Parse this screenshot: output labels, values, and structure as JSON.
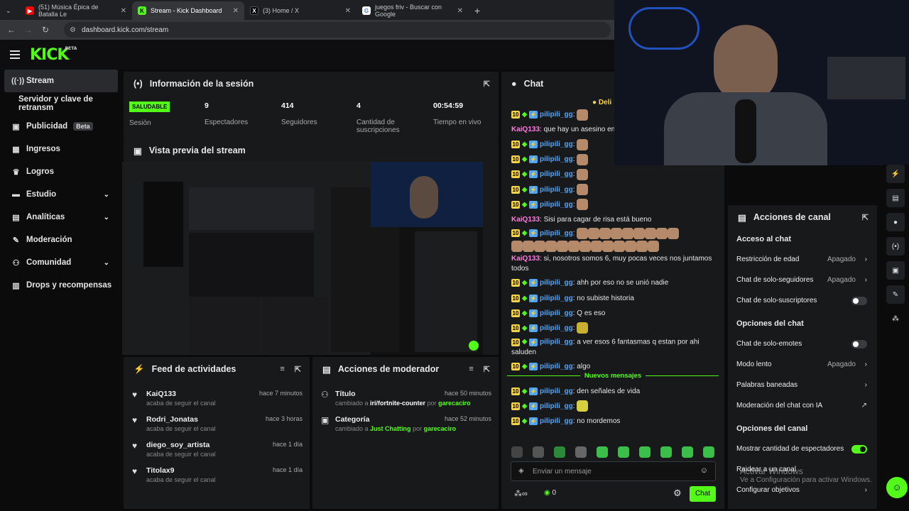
{
  "browser": {
    "tabs": [
      {
        "label": "(51) Música Épica de Batalla Le",
        "color": "#ff0000",
        "glyph": "▶"
      },
      {
        "label": "Stream - Kick Dashboard",
        "color": "#53fc18",
        "glyph": "K"
      },
      {
        "label": "(3) Home / X",
        "color": "#000000",
        "glyph": "X"
      },
      {
        "label": "juegos friv - Buscar con Google",
        "color": "#ffffff",
        "glyph": "G"
      }
    ],
    "url": "dashboard.kick.com/stream"
  },
  "brand": {
    "logo": "KICK",
    "beta": "BETA"
  },
  "sidebar": {
    "items": [
      {
        "label": "Stream",
        "icon": "stream-icon"
      },
      {
        "label": "Servidor y clave de retransm"
      },
      {
        "label": "Publicidad",
        "badge": "Beta"
      },
      {
        "label": "Ingresos"
      },
      {
        "label": "Logros"
      },
      {
        "label": "Estudio"
      },
      {
        "label": "Analíticas"
      },
      {
        "label": "Moderación"
      },
      {
        "label": "Comunidad"
      },
      {
        "label": "Drops y recompensas"
      }
    ]
  },
  "session": {
    "title": "Información de la sesión",
    "status": "SALUDABLE",
    "status_label": "Sesión",
    "viewers": "9",
    "viewers_label": "Espectadores",
    "followers": "414",
    "followers_label": "Seguidores",
    "subs": "4",
    "subs_label": "Cantidad de suscripciones",
    "time": "00:54:59",
    "time_label": "Tiempo en vivo"
  },
  "preview": {
    "title": "Vista previa del stream"
  },
  "feed": {
    "title": "Feed de actividades",
    "items": [
      {
        "name": "KaiQ133",
        "sub": "acaba de seguir el canal",
        "time": "hace 7 minutos"
      },
      {
        "name": "Rodri_Jonatas",
        "sub": "acaba de seguir el canal",
        "time": "hace 3 horas"
      },
      {
        "name": "diego_soy_artista",
        "sub": "acaba de seguir el canal",
        "time": "hace 1 día"
      },
      {
        "name": "Titolax9",
        "sub": "acaba de seguir el canal",
        "time": "hace 1 día"
      }
    ]
  },
  "modactions": {
    "title": "Acciones de moderador",
    "items": [
      {
        "name": "Título",
        "pre": "cambiado a",
        "value": "iri/fortnite-counter",
        "by": "por",
        "user": "garecaciro",
        "time": "hace 50 minutos"
      },
      {
        "name": "Categoría",
        "pre": "cambiado a",
        "value": "Just Chatting",
        "by": "por",
        "user": "garecaciro",
        "time": "hace 52 minutos"
      }
    ]
  },
  "chat": {
    "title": "Chat",
    "pinned": "Deli",
    "lines": [
      {
        "user": "pilipili_gg",
        "type": "emote",
        "text": ""
      },
      {
        "user": "KaiQ133",
        "type": "plain",
        "text": "que hay un asesino entr"
      },
      {
        "user": "pilipili_gg",
        "type": "emote",
        "text": ""
      },
      {
        "user": "pilipili_gg",
        "type": "emote",
        "text": ""
      },
      {
        "user": "pilipili_gg",
        "type": "emote",
        "text": ""
      },
      {
        "user": "pilipili_gg",
        "type": "emote",
        "text": ""
      },
      {
        "user": "pilipili_gg",
        "type": "emote",
        "text": ""
      },
      {
        "user": "KaiQ133",
        "type": "plain",
        "text": "Sisi para cagar de risa está bueno"
      }
    ],
    "lines2": [
      {
        "user": "pilipili_gg",
        "text": "ahh por eso no se unió nadie"
      },
      {
        "user": "pilipili_gg",
        "text": "no subiste historia"
      },
      {
        "user": "pilipili_gg",
        "text": "Q es eso"
      },
      {
        "user": "pilipili_gg",
        "text": ""
      }
    ],
    "kai_long": "si, nosotros somos 6, muy pocas veces nos juntamos todos",
    "long_msg": "a ver esos 6 fantasmas q estan por ahi saluden",
    "algo": "algo",
    "new_messages": "Nuevos mensajes",
    "lines3": [
      {
        "user": "pilipili_gg",
        "text": "den señales de vida"
      },
      {
        "user": "pilipili_gg",
        "text": ""
      },
      {
        "user": "pilipili_gg",
        "text": "no mordemos"
      }
    ],
    "input_placeholder": "Enviar un mensaje",
    "points": "0",
    "send": "Chat"
  },
  "channel": {
    "title": "Acciones de canal",
    "chat_access": "Acceso al chat",
    "age": "Restricción de edad",
    "age_val": "Apagado",
    "followers_only": "Chat de solo-seguidores",
    "followers_val": "Apagado",
    "subs_only": "Chat de solo-suscriptores",
    "chat_options": "Opciones del chat",
    "emotes_only": "Chat de solo-emotes",
    "slow": "Modo lento",
    "slow_val": "Apagado",
    "banned": "Palabras baneadas",
    "ai_mod": "Moderación del chat con IA",
    "channel_options": "Opciones del canal",
    "show_viewers": "Mostrar cantidad de espectadores",
    "raid": "Raidear a un canal",
    "goals": "Configurar objetivos"
  },
  "watermark": {
    "line1": "Activar Windows",
    "line2": "Ve a Configuración para activar Windows."
  }
}
